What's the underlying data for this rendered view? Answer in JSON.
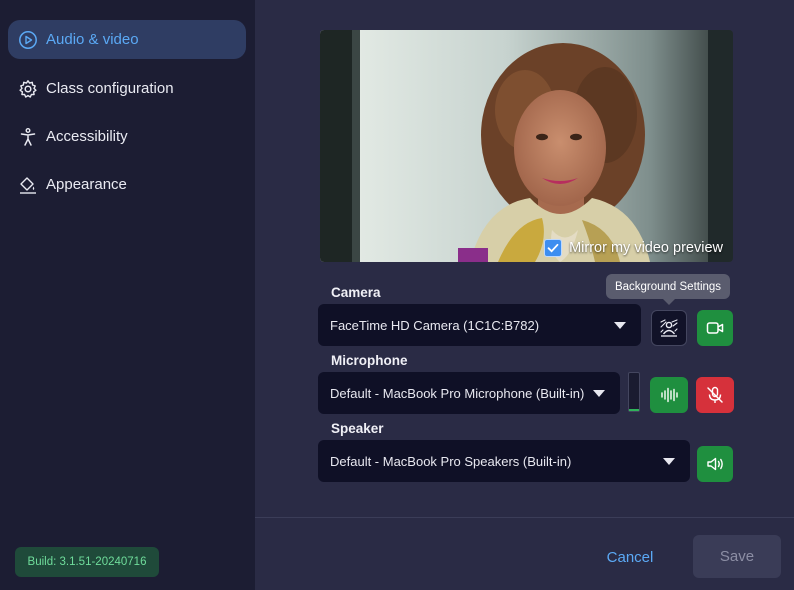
{
  "sidebar": {
    "items": [
      {
        "label": "Audio & video",
        "icon": "play-circle-icon",
        "active": true
      },
      {
        "label": "Class configuration",
        "icon": "gear-icon",
        "active": false
      },
      {
        "label": "Accessibility",
        "icon": "accessibility-icon",
        "active": false
      },
      {
        "label": "Appearance",
        "icon": "paint-bucket-icon",
        "active": false
      }
    ],
    "build": "Build: 3.1.51-20240716"
  },
  "preview": {
    "mirror_label": "Mirror my video preview",
    "mirror_checked": true
  },
  "camera": {
    "label": "Camera",
    "value": "FaceTime HD Camera (1C1C:B782)",
    "tooltip": "Background Settings"
  },
  "microphone": {
    "label": "Microphone",
    "value": "Default - MacBook Pro Microphone (Built-in)",
    "level": 0.05
  },
  "speaker": {
    "label": "Speaker",
    "value": "Default - MacBook Pro Speakers (Built-in)"
  },
  "footer": {
    "cancel_label": "Cancel",
    "save_label": "Save"
  },
  "colors": {
    "accent": "#5ba9f5",
    "green": "#1f8f3f",
    "red": "#d6313b",
    "sidebar_bg": "#1c1d33",
    "main_bg": "#2a2b45"
  }
}
